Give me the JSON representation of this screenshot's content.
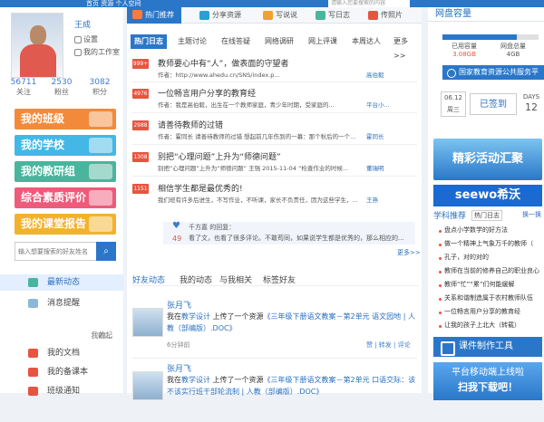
{
  "topbar": {
    "search_placeholder": "请输入您要搜索的内容",
    "nav": "首页  资源  个人空间"
  },
  "profile": {
    "name": "王成",
    "settings": "设置",
    "workspace": "我的工作室",
    "stats": [
      {
        "value": "56711",
        "label": "关注"
      },
      {
        "value": "2530",
        "label": "粉丝"
      },
      {
        "value": "3082",
        "label": "积分"
      }
    ]
  },
  "left_menu": [
    {
      "label": "我的班级",
      "color": "#f38a3b"
    },
    {
      "label": "我的学校",
      "color": "#43b8e6"
    },
    {
      "label": "我的教研组",
      "color": "#48b59c"
    },
    {
      "label": "综合素质评价",
      "color": "#ee5a7a"
    },
    {
      "label": "我的课堂报告",
      "color": "#f2b22c"
    }
  ],
  "left_search": {
    "placeholder": "输入想要搜索的好友姓名"
  },
  "left_nav": [
    {
      "label": "最新动态",
      "color": "#48b59c"
    },
    {
      "label": "消息提醒",
      "color": "#8bb8d8"
    }
  ],
  "my_section": {
    "title": "我的...",
    "collapse": "收起"
  },
  "my_links": [
    {
      "label": "我的文档",
      "color": "#e8543f"
    },
    {
      "label": "我的备课本",
      "color": "#e8543f"
    },
    {
      "label": "班级通知",
      "color": "#e8543f"
    }
  ],
  "top_tabs": [
    {
      "label": "热门推荐",
      "color": "#ff7a3d"
    },
    {
      "label": "分享资源",
      "color": "#2a9fd6"
    },
    {
      "label": "写说说",
      "color": "#f3a02c"
    },
    {
      "label": "写日志",
      "color": "#48b59c"
    },
    {
      "label": "传照片",
      "color": "#e8543f"
    }
  ],
  "sub_tabs": [
    "热门日志",
    "主题讨论",
    "在线答疑",
    "网络调研",
    "网上评课",
    "本周达人",
    "更多>>"
  ],
  "posts": [
    {
      "badge": "999+",
      "title": "教师要心中有“人”，做表面的守望者",
      "meta": "作者：",
      "excerpt": "http://www.ahedu.cn/SNS/index.p...",
      "author": "高伯毅"
    },
    {
      "badge": "4976",
      "title": "一位畅言用户分享的教育经",
      "meta": "作者：",
      "excerpt": "我是高伯毅，出生在一个教师家庭，青少年时期，受家庭的...",
      "author": "平台小..."
    },
    {
      "badge": "2988",
      "title": "请善待教师的过错",
      "meta": "作者：",
      "excerpt": "霍同长 请善待教师的过错 想起前几年伤到的一幕：那个秋后的一个...",
      "author": "霍同长"
    },
    {
      "badge": "1308",
      "title": "别把“心理问题”上升为“师德问题”",
      "meta": "别把“心理问题”上升为“师德问题”",
      "excerpt": "王强 2015-11-04 “检查作业的时候...",
      "author": "董瑞明"
    },
    {
      "badge": "1151",
      "title": "相信学生都是最优秀的!",
      "meta": "我们班有许多后进生，不写作业，不听课，家长不负责任，因为这些学生，...",
      "excerpt": "",
      "author": "王燕"
    }
  ],
  "reply": {
    "heart": "♥",
    "count": "49",
    "line1": "千方嘉 的回复：",
    "line2": "看了文，也看了很多评论。不敢苟同，如果说学生都是优秀的，那么相应的..."
  },
  "more_link": "更多>>",
  "feed_tabs": [
    "好友动态",
    "我的动态",
    "与我相关",
    "标签好友"
  ],
  "feed": [
    {
      "name": "张月飞",
      "desc_pre": "我在",
      "desc_link": "教学设计",
      "desc_mid": "上传了一个资源",
      "desc_title": "《三年级下册语文教案－第2单元 语文园地 | 人教（部编版）.DOC》",
      "time": "6分钟前",
      "actions": "赞  |  转发  |  评论"
    },
    {
      "name": "张月飞",
      "desc_pre": "我在",
      "desc_link": "教学设计",
      "desc_mid": "上传了一个资源",
      "desc_title": "《三年级下册语文教案－第2单元 口语交际：该不该实行班干部轮流制 | 人教（部编版）.DOC》",
      "time": "",
      "actions": ""
    }
  ],
  "right": {
    "title": "网盘容量",
    "used_label": "已用容量",
    "used_value": "3.08GB",
    "total_label": "网盘总量",
    "total_value": "4GB",
    "used_fraction": 0.77,
    "service": "国家教育资源公共服务平台",
    "date": "06.12",
    "weekday": "周三",
    "sign_button": "已签到",
    "days_label": "DAYS",
    "days_value": "12",
    "banner1": "精彩活动汇聚",
    "banner2": "seewo希沃",
    "rec_title": "学科推荐",
    "rec_dropdown": "热门日志",
    "rec_switch": "换一换",
    "rec_items": [
      "盘点小学数学的好方法",
      "做一个精神上气象万千的教师（",
      "孔子，对的对的",
      "教师在当前的修养自己的职业良心",
      "教师“忙”“累”们何能缓解",
      "关系和谐制造属于农村教师队伍",
      "一位畅言用户分享的教育经",
      "让我的孩子上北大（转载）"
    ],
    "tool": "课件制作工具",
    "promo_l1": "平台移动端上线啦",
    "promo_l2": "扫我下载吧！"
  }
}
